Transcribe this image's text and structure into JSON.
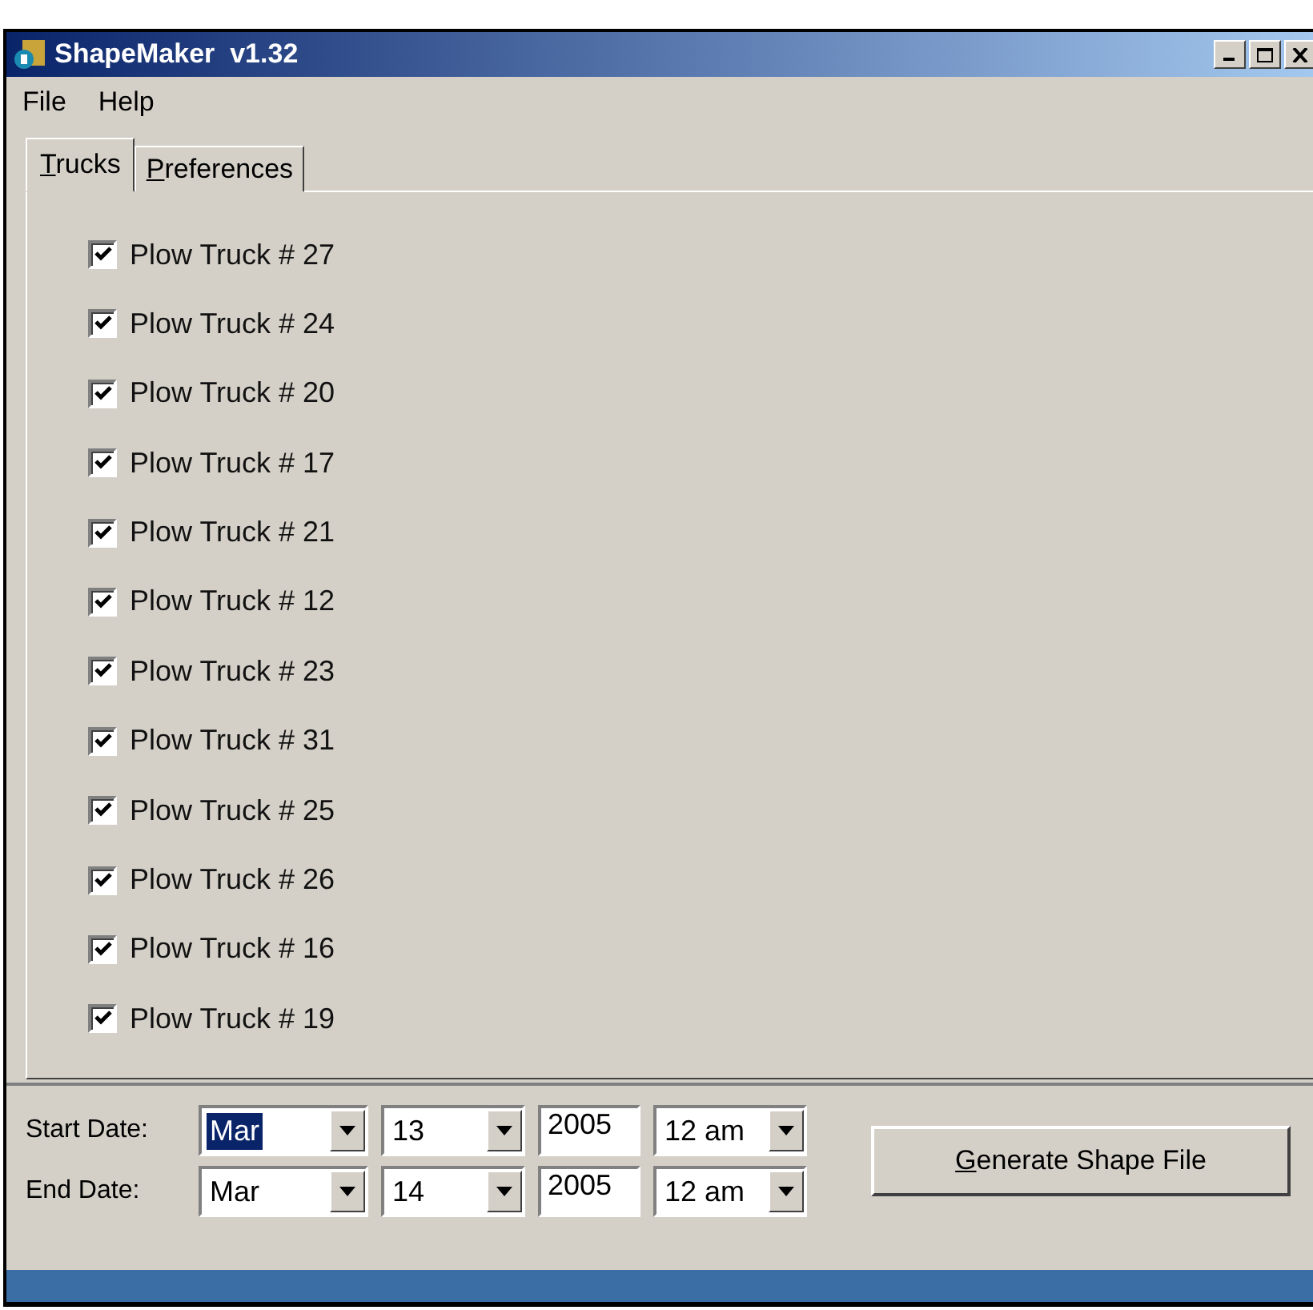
{
  "window": {
    "title": "ShapeMaker  v1.32"
  },
  "menu": [
    "File",
    "Help"
  ],
  "tabs": [
    {
      "label": "Trucks",
      "selected": true
    },
    {
      "label": "Preferences",
      "selected": false
    }
  ],
  "trucks": [
    {
      "label": "Plow Truck # 27",
      "checked": true
    },
    {
      "label": "Plow Truck # 24",
      "checked": true
    },
    {
      "label": "Plow Truck # 20",
      "checked": true
    },
    {
      "label": "Plow Truck # 17",
      "checked": true
    },
    {
      "label": "Plow Truck # 21",
      "checked": true
    },
    {
      "label": "Plow Truck # 12",
      "checked": true
    },
    {
      "label": "Plow Truck # 23",
      "checked": true
    },
    {
      "label": "Plow Truck # 31",
      "checked": true
    },
    {
      "label": "Plow Truck # 25",
      "checked": true
    },
    {
      "label": "Plow Truck # 26",
      "checked": true
    },
    {
      "label": "Plow Truck # 16",
      "checked": true
    },
    {
      "label": "Plow Truck # 19",
      "checked": true
    }
  ],
  "dates": [
    {
      "label": "Start Date:",
      "month": {
        "value": "Mar",
        "focused": true
      },
      "day": {
        "value": "13",
        "focused": false
      },
      "year": "2005",
      "hour": {
        "value": "12 am",
        "focused": false
      }
    },
    {
      "label": "End Date:",
      "month": {
        "value": "Mar",
        "focused": false
      },
      "day": {
        "value": "14",
        "focused": false
      },
      "year": "2005",
      "hour": {
        "value": "12 am",
        "focused": false
      }
    }
  ],
  "generate_button": "Generate Shape File"
}
